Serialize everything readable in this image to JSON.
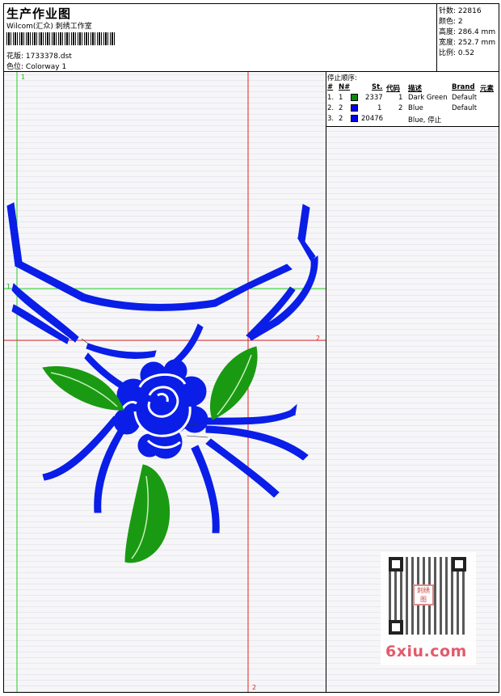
{
  "header": {
    "title": "生产作业图",
    "subtitle": "Wilcom(汇众) 刺绣工作室",
    "design_label": "花版:",
    "design_value": "1733378.dst",
    "colorway_label": "色位:",
    "colorway_value": "Colorway 1"
  },
  "stats": [
    {
      "label": "针数:",
      "value": "22816"
    },
    {
      "label": "颜色:",
      "value": "2"
    },
    {
      "label": "高度:",
      "value": "286.4 mm"
    },
    {
      "label": "宽度:",
      "value": "252.7 mm"
    },
    {
      "label": "比例:",
      "value": "0.52"
    }
  ],
  "stop_sequence": {
    "title": "停止顺序:",
    "columns": [
      "#",
      "N#",
      "St.",
      "代码",
      "描述",
      "Brand",
      "元素"
    ],
    "rows": [
      {
        "num": "1.",
        "n": "1",
        "color": "#0a8a0a",
        "st": "2337",
        "code": "1",
        "desc": "Dark Green",
        "brand": "Default"
      },
      {
        "num": "2.",
        "n": "2",
        "color": "#0000ee",
        "st": "1",
        "code": "2",
        "desc": "Blue",
        "brand": "Default"
      },
      {
        "num": "3.",
        "n": "2",
        "color": "#0000ee",
        "st": "20476",
        "code": "",
        "desc": "Blue, 停止",
        "brand": ""
      }
    ]
  },
  "guides": {
    "green_v_label": "1",
    "green_h_label": "1",
    "red_h_label": "2",
    "red_v_label": "2"
  },
  "colors": {
    "stitch_blue": "#0a1ee8",
    "stitch_green": "#1a9a12",
    "guide_green": "#22cc22",
    "guide_red": "#dd2222"
  },
  "watermark": {
    "text": "6xiu.com",
    "logo_text": "刺绣图"
  }
}
